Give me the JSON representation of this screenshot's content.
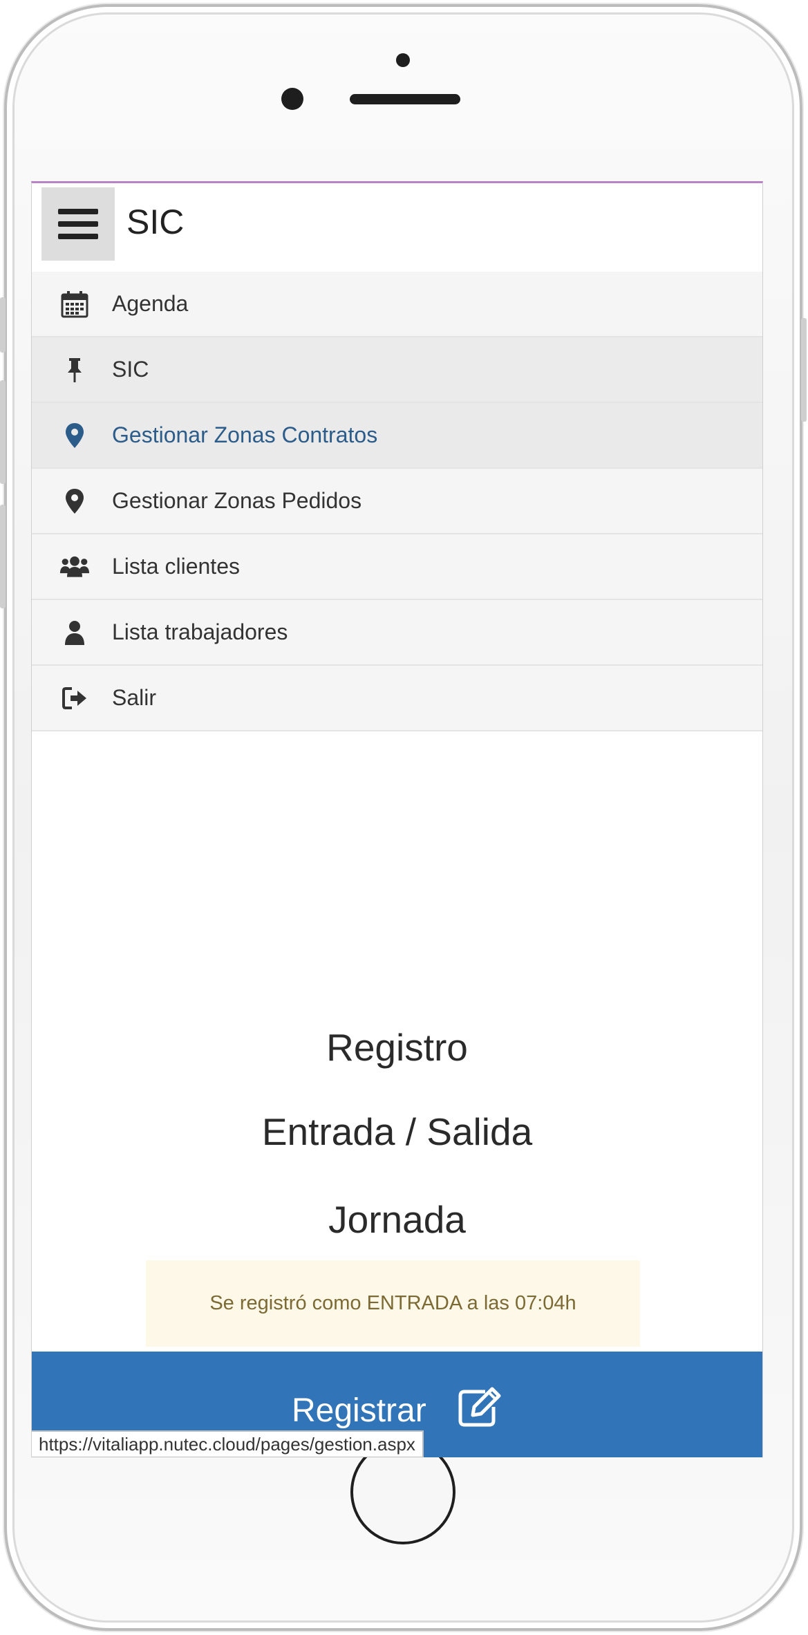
{
  "app": {
    "title": "SIC"
  },
  "menu": {
    "items": [
      {
        "label": "Agenda",
        "icon": "calendar-icon"
      },
      {
        "label": "SIC",
        "icon": "pin-icon"
      },
      {
        "label": "Gestionar Zonas Contratos",
        "icon": "map-marker-icon",
        "active": true
      },
      {
        "label": "Gestionar Zonas Pedidos",
        "icon": "map-marker-icon"
      },
      {
        "label": "Lista clientes",
        "icon": "users-icon"
      },
      {
        "label": "Lista trabajadores",
        "icon": "user-icon"
      },
      {
        "label": "Salir",
        "icon": "sign-out-icon"
      }
    ]
  },
  "main": {
    "heading_line1": "Registro",
    "heading_line2": "Entrada / Salida",
    "heading_line3": "Jornada",
    "notice": "Se registró como ENTRADA a las 07:04h",
    "register_label": "Registrar",
    "register_icon": "edit-icon"
  },
  "status_url": "https://vitaliapp.nutec.cloud/pages/gestion.aspx",
  "colors": {
    "accent": "#3175b8",
    "active_link": "#2b5c8a",
    "notice_bg": "#fdf8e8",
    "notice_text": "#7c6a34"
  }
}
